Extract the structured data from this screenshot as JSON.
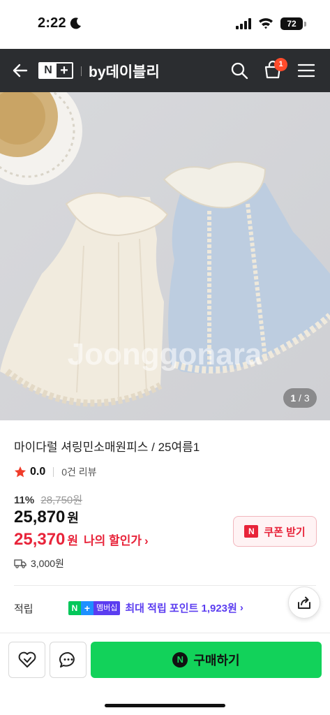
{
  "status_bar": {
    "time": "2:22",
    "battery": "72"
  },
  "header": {
    "logo_n": "N",
    "logo_plus": "+",
    "store_name": "by데이블리",
    "cart_count": "1"
  },
  "gallery": {
    "current": "1",
    "separator": "/",
    "total": "3",
    "watermark": "Joonggonara"
  },
  "product": {
    "title": "마이다럴 셔링민소매원피스 / 25여름1",
    "rating": "0.0",
    "review_count": "0건 리뷰",
    "discount_rate": "11%",
    "original_price": "28,750원",
    "sale_price": "25,870",
    "price_unit": "원",
    "my_price": "25,370",
    "my_price_unit": "원",
    "my_price_label": "나의 할인가",
    "my_price_chevron": "›",
    "shipping_fee": "3,000원"
  },
  "coupon": {
    "icon_letter": "N",
    "label": "쿠폰 받기"
  },
  "points": {
    "label": "적립",
    "badge_n": "N",
    "badge_plus": "+",
    "badge_membership": "멤버십",
    "text": "최대 적립 포인트 1,923원",
    "chevron": "›"
  },
  "bottom_bar": {
    "buy_icon_letter": "N",
    "buy_label": "구매하기"
  },
  "colors": {
    "header_bg": "#2b2d30",
    "accent_red": "#e8243a",
    "buy_green": "#12d25a",
    "membership_purple": "#5b3df0"
  }
}
